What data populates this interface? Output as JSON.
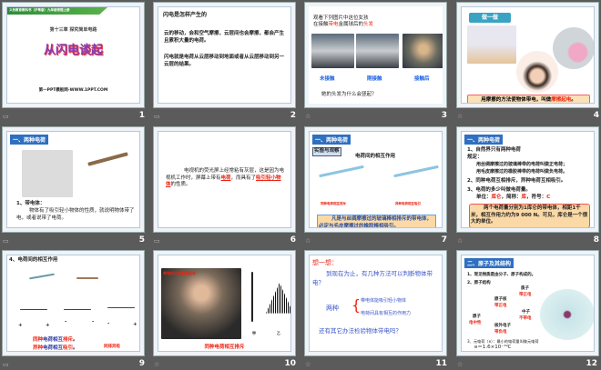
{
  "slides": [
    {
      "num": "1",
      "top": "义务教育教科书（沪粤版）九年级物理上册",
      "chapter": "第十三章 探究简单电路",
      "title": "从闪电谈起",
      "footer": "第一PPT模板网-WWW.1PPT.COM"
    },
    {
      "num": "2",
      "heading": "闪电是怎样产生的",
      "p1": "云的移动，会和空气摩擦，云层间也会摩擦，都会产生且累积大量的电荷。",
      "p2": "闪电就是电荷从云层移动到地面或者从云层移动到另一云层的结果。"
    },
    {
      "num": "3",
      "intro1": "观看下列图片中这位女孩",
      "intro2a": "在接触",
      "intro2b": "带电",
      "intro2c": "金属球后的",
      "intro2d": "头发",
      "l1": "未接触",
      "l2": "刚接触",
      "l3": "接触后",
      "q": "她的头发为什么会竖起？"
    },
    {
      "num": "4",
      "badge": "做一做",
      "caption_a": "用摩擦的方法使物体带电，叫做",
      "caption_b": "摩擦起电",
      "caption_c": "。"
    },
    {
      "num": "5",
      "header": "一、两种电荷",
      "item": "1、带电体：",
      "body": "物体有了吸引轻小物体的性质，就说明物体带了电，或者说带了电荷。"
    },
    {
      "num": "6",
      "p_a": "电视机的荧光屏上经常粘有灰层，这是因为电视机工作时，屏幕上带有",
      "blank1": "电荷",
      "p_b": "，而具有了",
      "blank2": "吸引轻小物体",
      "p_c": "的性质。"
    },
    {
      "num": "7",
      "header": "一、两种电荷",
      "tag": "实验与观察",
      "subtitle": "电荷间的相互作用",
      "cap1": "同种电荷相互排斥",
      "cap2": "异种电荷相互吸引",
      "box": "凡是与丝绸摩擦过的玻璃棒相排斥的带电体，必定与毛皮摩擦过的橡胶棒相吸引。"
    },
    {
      "num": "8",
      "header": "一、两种电荷",
      "l1": "1、自然界只有两种电荷",
      "l2": "规定：",
      "l3": "用丝绸摩擦过的玻璃棒带的电荷叫做正电荷；",
      "l4": "用毛皮摩擦过的橡胶棒带的电荷叫做负电荷。",
      "l5": "2、同种电荷互相排斥，异种电荷互相吸引。",
      "l6": "3、电荷的多少叫做电荷量。",
      "unit_a": "单位：",
      "unit_b": "库仑",
      "unit_c": "，简称：",
      "unit_d": "库",
      "unit_e": "，符号：",
      "unit_f": "C",
      "box": "两个电荷量分别为1库仑的带电体，相距1千米，相互作用力约为9 000 N。可见，库仑是一个很大的单位。"
    },
    {
      "num": "9",
      "heading": "4、电荷间的相互作用",
      "signs": [
        "+",
        "+",
        "-",
        "-",
        "-",
        "+"
      ],
      "r1a": "同种",
      "r1b": "电荷相互",
      "r1c": "排斥",
      "r1d": "。",
      "r2a": "异种",
      "r2b": "电荷相互",
      "r2c": "吸引",
      "r2d": "。",
      "side": "同排异吸"
    },
    {
      "num": "10",
      "overlay": "带电的头发都竖起来",
      "l1": "甲",
      "l2": "乙",
      "caption": "同种电荷相互排斥"
    },
    {
      "num": "11",
      "heading": "想一想：",
      "q": "到现在为止，有几种方法可以判断物体带电？",
      "two": "两种",
      "m1": "带电体能吸引轻小物体",
      "m2": "电荷间具有相互的作用力",
      "q2": "还有其它办法检验物体带电吗？"
    },
    {
      "num": "12",
      "header": "二、原子及其结构",
      "l1": "1、常见物质是由分子、原子构成的。",
      "l2": "2、原子结构",
      "atom": "原子",
      "neutral": "电中性",
      "nucleus": "原子核",
      "pos": "带正电",
      "proton": "质子",
      "pos2": "带正电",
      "neutron": "中子",
      "none": "不带电",
      "electron": "核外电子",
      "neg": "带负电",
      "l3": "3、元电荷（e）：最小的电荷量叫做元电荷",
      "e": "e＝1.6×10⁻¹⁹C"
    }
  ]
}
